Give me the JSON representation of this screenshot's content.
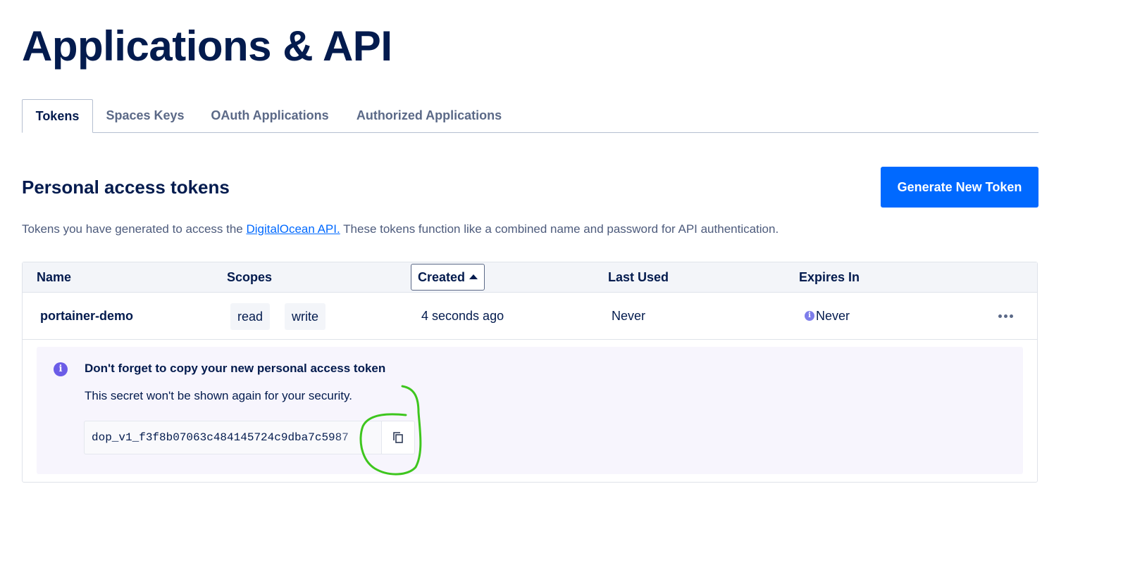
{
  "page": {
    "title": "Applications & API"
  },
  "tabs": [
    {
      "label": "Tokens",
      "active": true
    },
    {
      "label": "Spaces Keys",
      "active": false
    },
    {
      "label": "OAuth Applications",
      "active": false
    },
    {
      "label": "Authorized Applications",
      "active": false
    }
  ],
  "section": {
    "title": "Personal access tokens",
    "generate_button_label": "Generate New Token",
    "description_before": "Tokens you have generated to access the ",
    "description_link": "DigitalOcean API.",
    "description_after": " These tokens function like a combined name and password for API authentication."
  },
  "table": {
    "columns": [
      "Name",
      "Scopes",
      "Created",
      "Last Used",
      "Expires In"
    ],
    "sort_column": "Created",
    "sort_direction": "ascending",
    "rows": [
      {
        "name": "portainer-demo",
        "scopes": [
          "read",
          "write"
        ],
        "created": "4 seconds ago",
        "last_used": "Never",
        "expires_in": "Never"
      }
    ]
  },
  "notice": {
    "title": "Don't forget to copy your new personal access token",
    "body": "This secret won't be shown again for your security.",
    "token_value": "dop_v1_f3f8b07063c484145724c9dba7c5987"
  },
  "icons": {
    "info": "info-icon",
    "copy": "copy-icon",
    "more": "more-horizontal-icon",
    "sort": "sort-ascending-icon"
  },
  "colors": {
    "primary": "#0069ff",
    "heading": "#031b4e",
    "notice_bg": "#f7f5fd",
    "info_accent": "#6b5ce7",
    "annotation": "#3ec61e"
  }
}
